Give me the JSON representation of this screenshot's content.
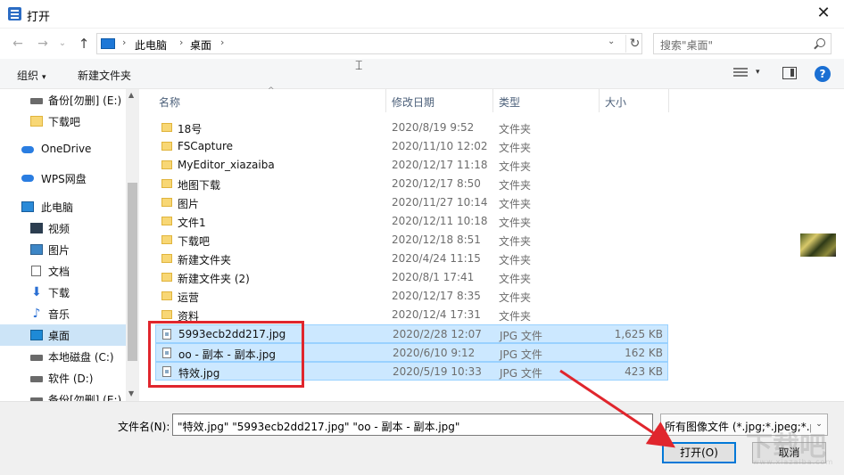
{
  "window": {
    "title": "打开",
    "close_glyph": "✕"
  },
  "nav": {
    "back": "←",
    "forward": "→",
    "recent": "⌄",
    "up": "↑"
  },
  "address": {
    "crumbs": [
      "此电脑",
      "桌面"
    ],
    "sep": "›",
    "drop": "⌄",
    "refresh": "↻"
  },
  "search": {
    "placeholder": "搜索\"桌面\""
  },
  "toolbar": {
    "organize": "组织",
    "new_folder": "新建文件夹",
    "caret": "▾"
  },
  "sidebar": {
    "items": [
      {
        "label": "备份[勿删] (E:)",
        "icon": "drive-icon"
      },
      {
        "label": "下载吧",
        "icon": "folder-icon"
      },
      {
        "label": "OneDrive",
        "icon": "cloud-icon"
      },
      {
        "label": "WPS网盘",
        "icon": "cloud-icon"
      },
      {
        "label": "此电脑",
        "icon": "computer-icon"
      },
      {
        "label": "视频",
        "icon": "video-icon"
      },
      {
        "label": "图片",
        "icon": "picture-icon"
      },
      {
        "label": "文档",
        "icon": "document-icon"
      },
      {
        "label": "下载",
        "icon": "download-icon"
      },
      {
        "label": "音乐",
        "icon": "music-icon"
      },
      {
        "label": "桌面",
        "icon": "desktop-icon",
        "selected": true
      },
      {
        "label": "本地磁盘 (C:)",
        "icon": "drive-icon"
      },
      {
        "label": "软件 (D:)",
        "icon": "drive-icon"
      },
      {
        "label": "备份[勿删] (E:)",
        "icon": "drive-icon"
      }
    ],
    "download_glyph": "⬇",
    "music_glyph": "♪",
    "scroll_up": "▲",
    "scroll_down": "▼"
  },
  "columns": {
    "name": "名称",
    "date": "修改日期",
    "type": "类型",
    "size": "大小",
    "sort_glyph": "^"
  },
  "files": [
    {
      "name": "18号",
      "date": "2020/8/19 9:52",
      "type": "文件夹",
      "size": "",
      "kind": "folder"
    },
    {
      "name": "FSCapture",
      "date": "2020/11/10 12:02",
      "type": "文件夹",
      "size": "",
      "kind": "folder"
    },
    {
      "name": "MyEditor_xiazaiba",
      "date": "2020/12/17 11:18",
      "type": "文件夹",
      "size": "",
      "kind": "folder"
    },
    {
      "name": "地图下载",
      "date": "2020/12/17 8:50",
      "type": "文件夹",
      "size": "",
      "kind": "folder"
    },
    {
      "name": "图片",
      "date": "2020/11/27 10:14",
      "type": "文件夹",
      "size": "",
      "kind": "folder"
    },
    {
      "name": "文件1",
      "date": "2020/12/11 10:18",
      "type": "文件夹",
      "size": "",
      "kind": "folder"
    },
    {
      "name": "下载吧",
      "date": "2020/12/18 8:51",
      "type": "文件夹",
      "size": "",
      "kind": "folder"
    },
    {
      "name": "新建文件夹",
      "date": "2020/4/24 11:15",
      "type": "文件夹",
      "size": "",
      "kind": "folder"
    },
    {
      "name": "新建文件夹 (2)",
      "date": "2020/8/1 17:41",
      "type": "文件夹",
      "size": "",
      "kind": "folder"
    },
    {
      "name": "运营",
      "date": "2020/12/17 8:35",
      "type": "文件夹",
      "size": "",
      "kind": "folder"
    },
    {
      "name": "资料",
      "date": "2020/12/4 17:31",
      "type": "文件夹",
      "size": "",
      "kind": "folder"
    },
    {
      "name": "5993ecb2dd217.jpg",
      "date": "2020/2/28 12:07",
      "type": "JPG 文件",
      "size": "1,625 KB",
      "kind": "image",
      "selected": true
    },
    {
      "name": "oo - 副本 - 副本.jpg",
      "date": "2020/6/10 9:12",
      "type": "JPG 文件",
      "size": "162 KB",
      "kind": "image",
      "selected": true
    },
    {
      "name": "特效.jpg",
      "date": "2020/5/19 10:33",
      "type": "JPG 文件",
      "size": "423 KB",
      "kind": "image",
      "selected": true
    }
  ],
  "bottom": {
    "filename_label": "文件名(N):",
    "filename_value": "\"特效.jpg\" \"5993ecb2dd217.jpg\" \"oo - 副本 - 副本.jpg\"",
    "filter_value": "所有图像文件 (*.jpg;*.jpeg;*.p",
    "filter_caret": "⌄",
    "open_button": "打开(O)",
    "cancel_button": "取消"
  },
  "watermark": {
    "big": "下载吧",
    "small": "www.xiazaiba.com"
  },
  "colors": {
    "selection": "#cce8ff",
    "accent": "#0078d7",
    "annotation": "#e0262d"
  }
}
